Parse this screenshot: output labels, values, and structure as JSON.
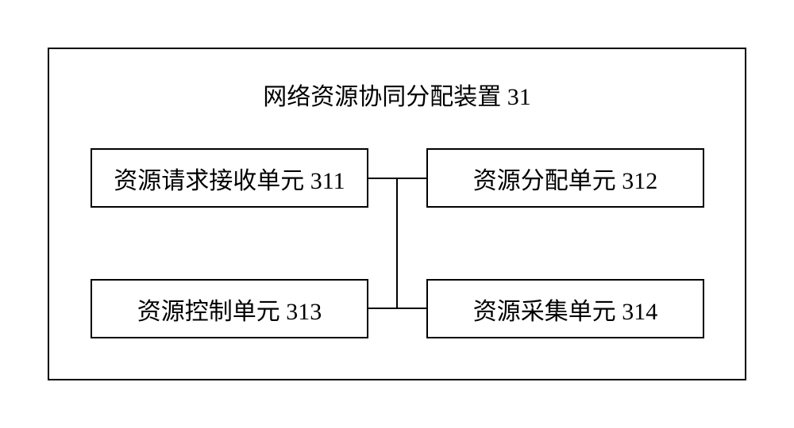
{
  "diagram": {
    "title": "网络资源协同分配装置 31",
    "units": {
      "u311": "资源请求接收单元 311",
      "u312": "资源分配单元 312",
      "u313": "资源控制单元 313",
      "u314": "资源采集单元 314"
    }
  }
}
